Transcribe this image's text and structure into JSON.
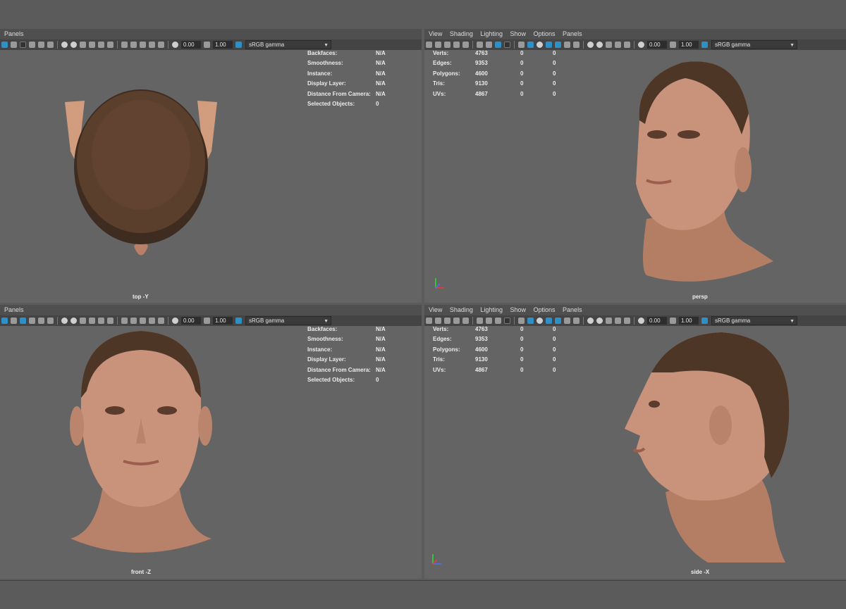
{
  "menus": {
    "short": [
      "Panels"
    ],
    "full": [
      "View",
      "Shading",
      "Lighting",
      "Show",
      "Options",
      "Panels"
    ]
  },
  "toolbar": {
    "value1": "0.00",
    "value2": "1.00",
    "colorspace": "sRGB gamma"
  },
  "hud_object": [
    {
      "label": "Backfaces:",
      "value": "N/A"
    },
    {
      "label": "Smoothness:",
      "value": "N/A"
    },
    {
      "label": "Instance:",
      "value": "N/A"
    },
    {
      "label": "Display Layer:",
      "value": "N/A"
    },
    {
      "label": "Distance From Camera:",
      "value": "N/A"
    },
    {
      "label": "Selected Objects:",
      "value": "0"
    }
  ],
  "hud_poly": [
    {
      "label": "Verts:",
      "total": "4763",
      "sel": "0",
      "comp": "0"
    },
    {
      "label": "Edges:",
      "total": "9353",
      "sel": "0",
      "comp": "0"
    },
    {
      "label": "Polygons:",
      "total": "4600",
      "sel": "0",
      "comp": "0"
    },
    {
      "label": "Tris:",
      "total": "9130",
      "sel": "0",
      "comp": "0"
    },
    {
      "label": "UVs:",
      "total": "4867",
      "sel": "0",
      "comp": "0"
    }
  ],
  "viewports": {
    "top": "top -Y",
    "persp": "persp",
    "front": "front -Z",
    "side": "side -X"
  },
  "colors": {
    "viewport_bg": "#646464",
    "toolbar_bg": "#444444",
    "accent": "#2f8fc7",
    "hair": "#5a3e2c",
    "skin": "#c9927a"
  }
}
